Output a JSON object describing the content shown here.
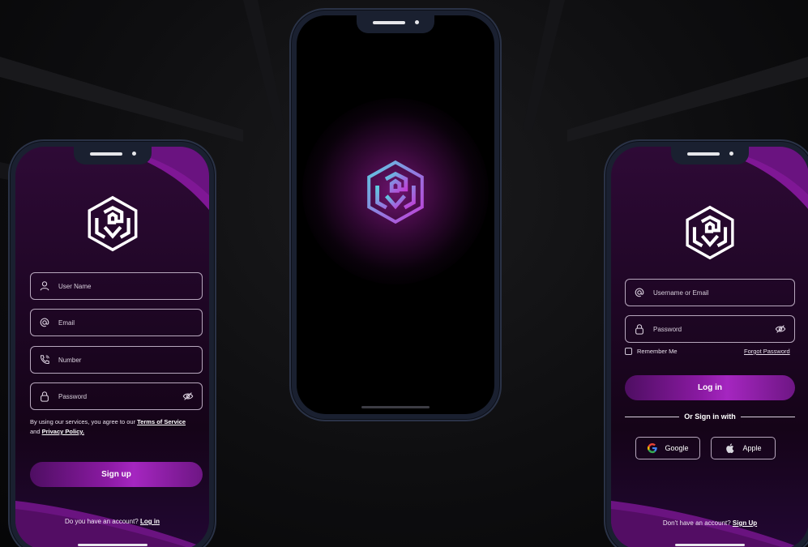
{
  "signup": {
    "username_placeholder": "User Name",
    "email_placeholder": "Email",
    "number_placeholder": "Number",
    "password_placeholder": "Password",
    "terms_prefix": "By using our services, you agree to our ",
    "terms_link": "Terms of Service",
    "terms_and": " and ",
    "privacy_link": "Privacy Policy.",
    "signup_button": "Sign up",
    "footer_question": "Do you have an account? ",
    "footer_link": "Log in"
  },
  "login": {
    "username_placeholder": "Username or Email",
    "password_placeholder": "Password",
    "remember_label": "Remember Me",
    "forgot_link": "Forgot Password",
    "login_button": "Log in",
    "divider_text": "Or Sign in with",
    "google_label": "Google",
    "apple_label": "Apple",
    "footer_question": "Don't have an account? ",
    "footer_link": "Sign Up"
  },
  "colors": {
    "background": "#0e0e10",
    "phone_frame": "#1a2030",
    "accent_purple": "#8b1aa3",
    "screen_dark_purple": "#1e0624"
  },
  "icons": [
    "logo-icon",
    "user-icon",
    "at-icon",
    "phone-icon",
    "lock-icon",
    "eye-off-icon",
    "google-icon",
    "apple-icon"
  ]
}
